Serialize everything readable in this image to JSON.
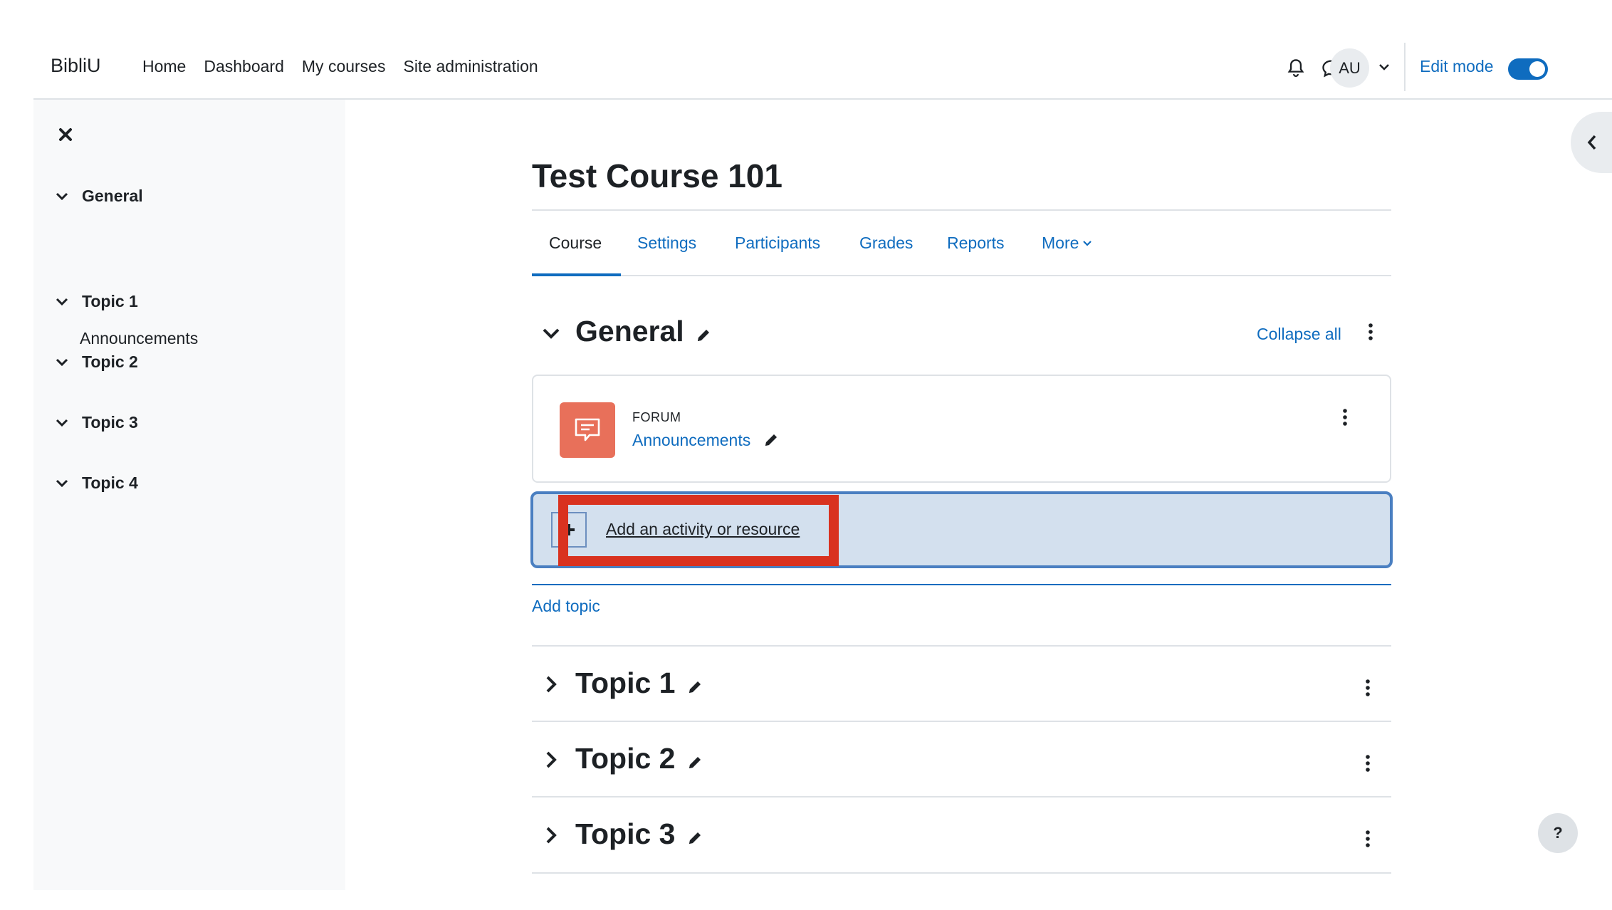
{
  "navbar": {
    "brand": "BibliU",
    "links": [
      "Home",
      "Dashboard",
      "My courses",
      "Site administration"
    ],
    "avatar_initials": "AU",
    "edit_mode_label": "Edit mode",
    "edit_mode_on": true
  },
  "drawer": {
    "sections": [
      {
        "label": "General",
        "items": [
          "Announcements"
        ]
      },
      {
        "label": "Topic 1",
        "items": []
      },
      {
        "label": "Topic 2",
        "items": []
      },
      {
        "label": "Topic 3",
        "items": []
      },
      {
        "label": "Topic 4",
        "items": []
      }
    ]
  },
  "course": {
    "title": "Test Course 101",
    "tabs": [
      "Course",
      "Settings",
      "Participants",
      "Grades",
      "Reports",
      "More"
    ],
    "active_tab": "Course"
  },
  "general_section": {
    "title": "General",
    "collapse_all_label": "Collapse all",
    "activity": {
      "type": "FORUM",
      "name": "Announcements"
    },
    "add_activity_label": "Add an activity or resource",
    "add_topic_label": "Add topic"
  },
  "topics": [
    {
      "title": "Topic 1"
    },
    {
      "title": "Topic 2"
    },
    {
      "title": "Topic 3"
    }
  ],
  "help_button_label": "?",
  "colors": {
    "link": "#0f6cbf",
    "forum_icon_bg": "#e8705a",
    "highlight": "#d9321f",
    "add_activity_bg": "#d3e0ee"
  }
}
